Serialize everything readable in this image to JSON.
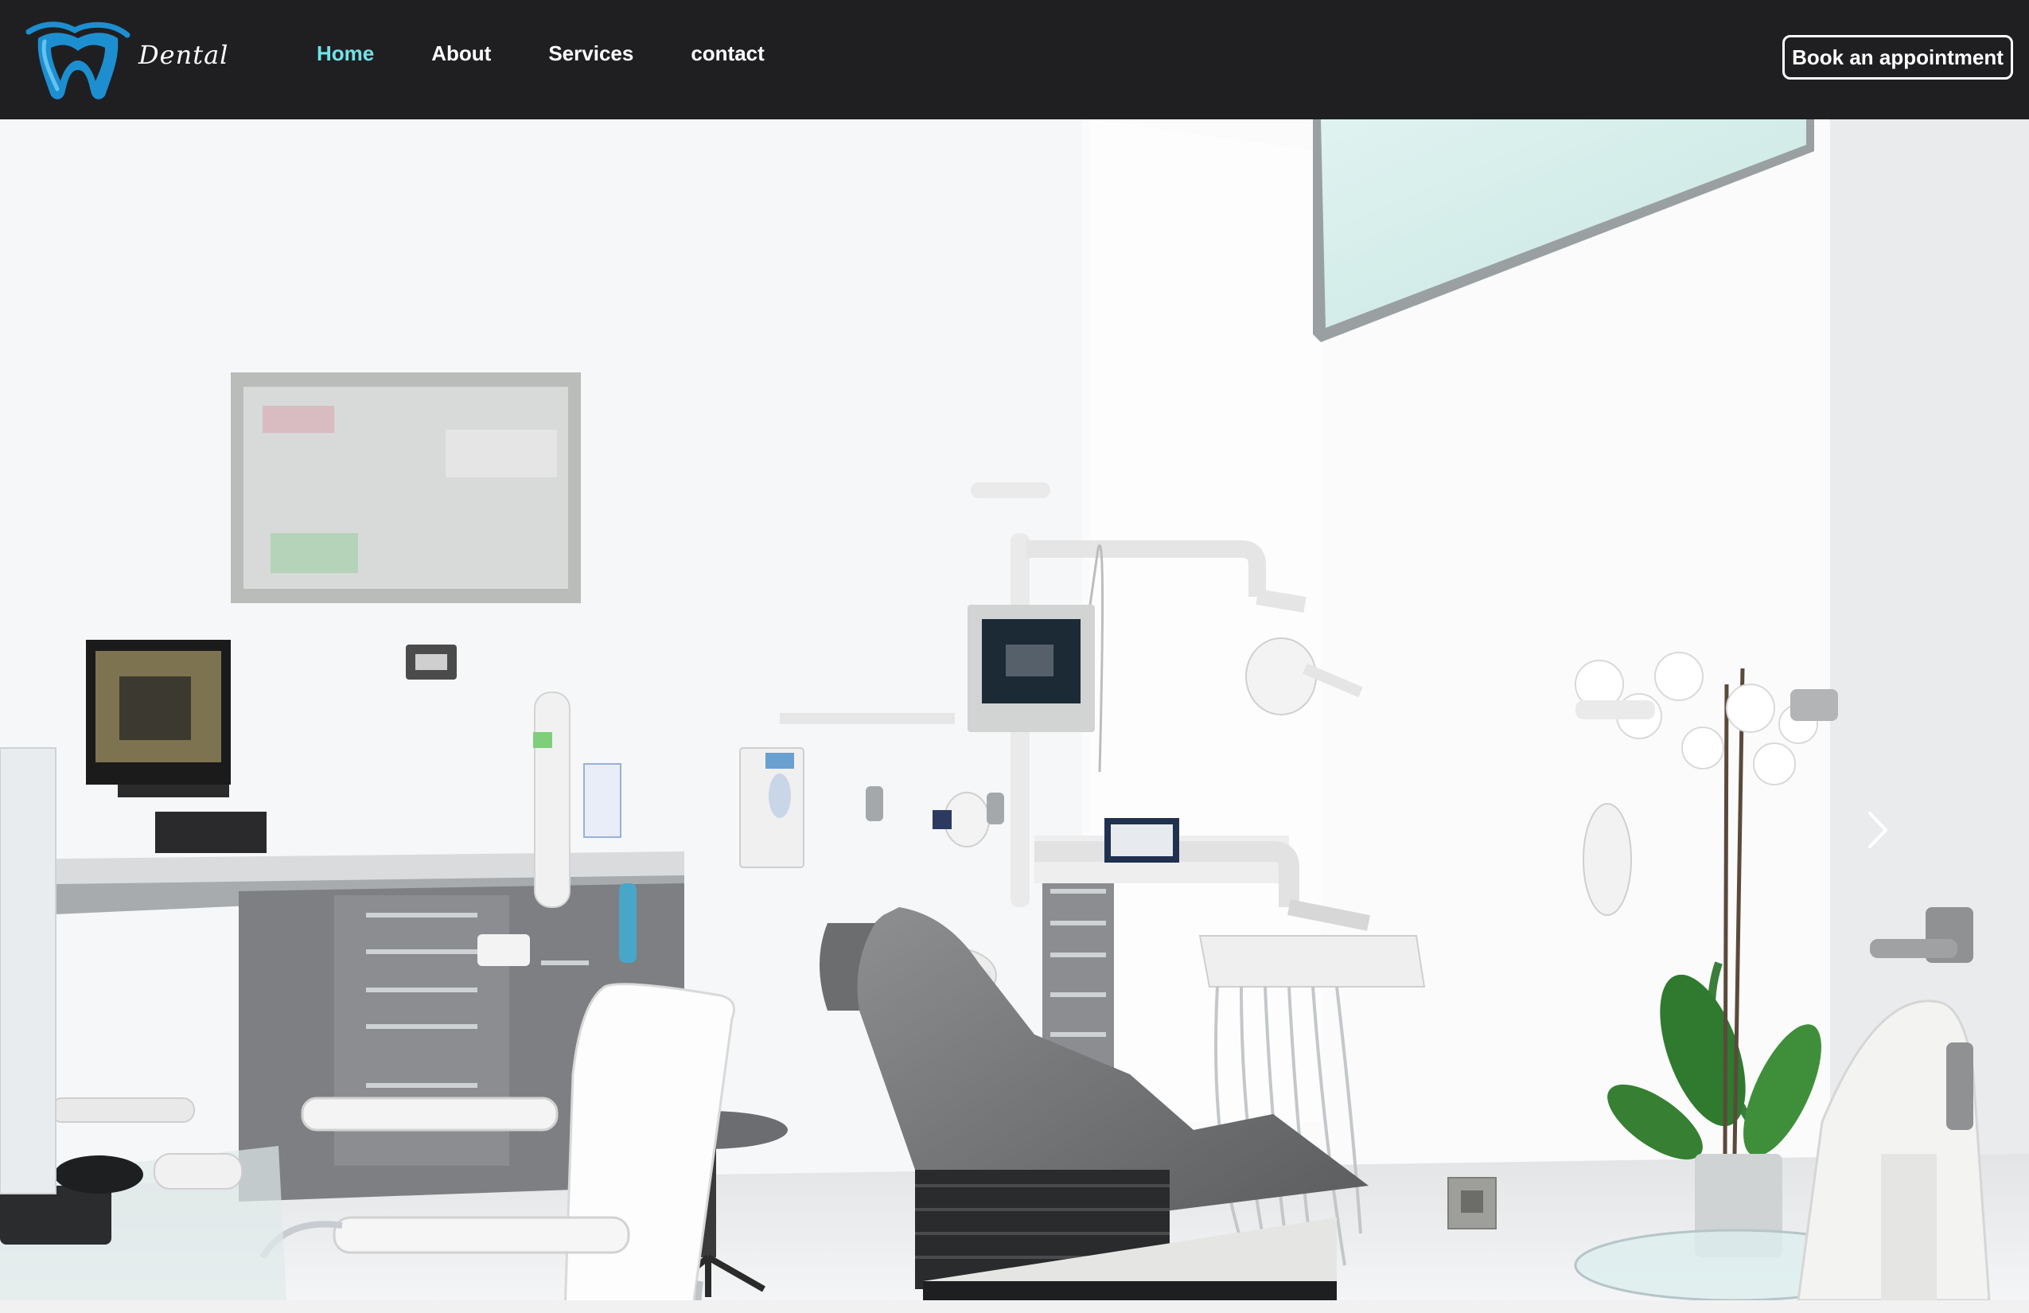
{
  "brand": {
    "name": "Dental",
    "icon": "tooth-icon",
    "logo_color": "#1d8fd0"
  },
  "nav": {
    "items": [
      {
        "label": "Home",
        "active": true
      },
      {
        "label": "About",
        "active": false
      },
      {
        "label": "Services",
        "active": false
      },
      {
        "label": "contact",
        "active": false
      }
    ],
    "active_color": "#6fe3e8"
  },
  "cta": {
    "label": "Book an appointment"
  },
  "hero": {
    "image": "dental-clinic-room-photo",
    "next_icon": "chevron-right-icon"
  },
  "colors": {
    "navbar_bg": "#1f1f22",
    "text": "#ffffff"
  }
}
